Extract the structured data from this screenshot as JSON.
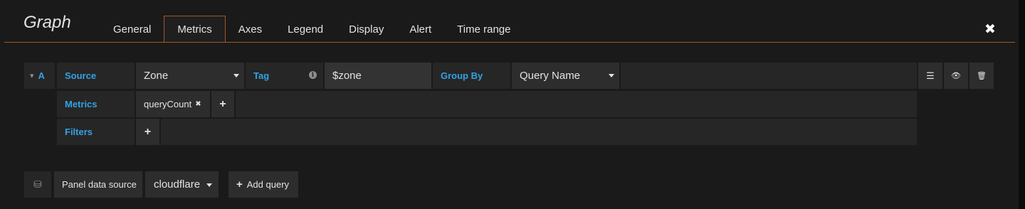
{
  "panel": {
    "title": "Graph"
  },
  "tabs": [
    "General",
    "Metrics",
    "Axes",
    "Legend",
    "Display",
    "Alert",
    "Time range"
  ],
  "close_glyph": "✖",
  "query": {
    "ref_id": "A",
    "collapse_glyph": "▾",
    "source_label": "Source",
    "source_value": "Zone",
    "tag_label": "Tag",
    "tag_info_glyph": "i",
    "tag_value": "$zone",
    "group_by_label": "Group By",
    "group_by_value": "Query Name",
    "metrics_label": "Metrics",
    "metric_item": "queryCount",
    "remove_glyph": "✖",
    "add_glyph": "+",
    "filters_label": "Filters"
  },
  "row_actions": {
    "menu_glyph": "☰",
    "eye_glyph": "👁",
    "trash_glyph": "🗑"
  },
  "footer": {
    "db_glyph": "⛁",
    "panel_data_source_label": "Panel data source",
    "data_source_value": "cloudflare",
    "add_query_plus": "+",
    "add_query_label": "Add query"
  },
  "colors": {
    "accent": "#a1562b",
    "label_blue": "#33a2e5",
    "bg": "#1a1a1a",
    "cell": "#262626"
  }
}
